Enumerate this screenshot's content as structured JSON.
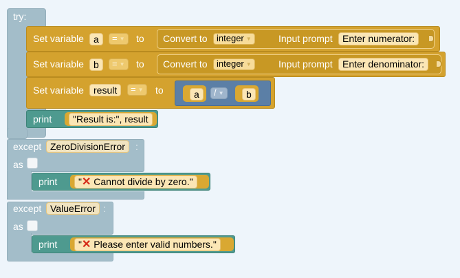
{
  "try_block": {
    "try_label": "try:",
    "set_rows": [
      {
        "prefix": "Set variable",
        "var": "a",
        "op": "=",
        "to": "to",
        "convert_label": "Convert to",
        "type_value": "integer",
        "input_label": "Input prompt",
        "prompt": "Enter numerator:"
      },
      {
        "prefix": "Set variable",
        "var": "b",
        "op": "=",
        "to": "to",
        "convert_label": "Convert to",
        "type_value": "integer",
        "input_label": "Input prompt",
        "prompt": "Enter denominator:"
      }
    ],
    "result_row": {
      "prefix": "Set variable",
      "var": "result",
      "op": "=",
      "to": "to",
      "left": "a",
      "operator": "/",
      "right": "b"
    },
    "print_row": {
      "label": "print",
      "args": "\"Result is:\", result"
    }
  },
  "except_blocks": [
    {
      "except_label": "except",
      "exception": "ZeroDivisionError",
      "colon": ":",
      "as_label": "as",
      "print_label": "print",
      "quote": "\"",
      "message": "Cannot divide by zero.\"",
      "icon": "cross-mark-icon"
    },
    {
      "except_label": "except",
      "exception": "ValueError",
      "colon": ":",
      "as_label": "as",
      "print_label": "print",
      "quote": "\"",
      "message": "Please enter valid numbers.\"",
      "icon": "cross-mark-icon"
    }
  ],
  "colors": {
    "background": "#eef5fb",
    "control_block": "#a3bdc9",
    "variable_block": "#d4a22e",
    "print_block": "#4e9a8f",
    "math_block": "#5b7fa6",
    "error_icon": "#d62a18"
  }
}
